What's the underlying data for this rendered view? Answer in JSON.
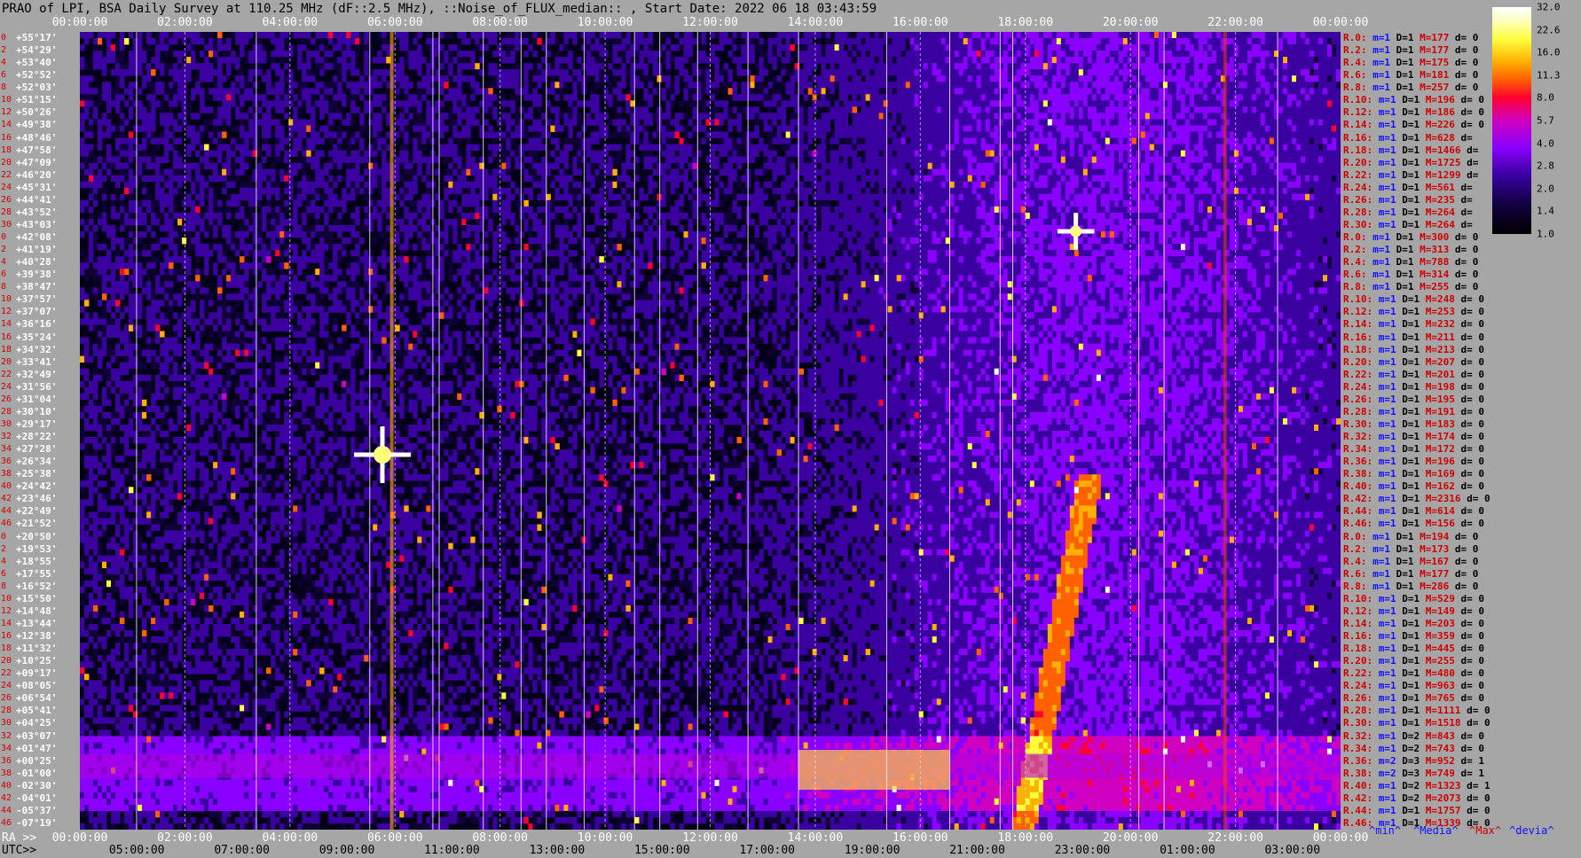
{
  "title": "PRAO of LPI, BSA Daily Survey at 110.25 MHz (dF::2.5 MHz), ::Noise_of_FLUX_median:: , Start Date: 2022 06 18 03:43:59",
  "colors": {
    "background": "#a6a6a6",
    "plot_background": "#05001a",
    "colormap": [
      "#000000",
      "#10003a",
      "#3a00a0",
      "#8a00ff",
      "#d000c0",
      "#ff0030",
      "#ff6000",
      "#ffb000",
      "#ffff40",
      "#ffffff"
    ],
    "stat_red": "#d00000",
    "stat_blue": "#1010ff"
  },
  "axes": {
    "top_ticks": [
      "00:00:00",
      "02:00:00",
      "04:00:00",
      "06:00:00",
      "08:00:00",
      "10:00:00",
      "12:00:00",
      "14:00:00",
      "16:00:00",
      "18:00:00",
      "20:00:00",
      "22:00:00",
      "00:00:00"
    ],
    "bottom_ra_prefix": "RA >>",
    "bottom_ra_ticks": [
      "00:00:00",
      "02:00:00",
      "04:00:00",
      "06:00:00",
      "08:00:00",
      "10:00:00",
      "12:00:00",
      "14:00:00",
      "16:00:00",
      "18:00:00",
      "20:00:00",
      "22:00:00",
      "00:00:00"
    ],
    "bottom_utc_prefix": "UTC>>",
    "bottom_utc_ticks": [
      "05:00:00",
      "07:00:00",
      "09:00:00",
      "11:00:00",
      "13:00:00",
      "15:00:00",
      "17:00:00",
      "19:00:00",
      "21:00:00",
      "23:00:00",
      "01:00:00",
      "03:00:00"
    ]
  },
  "chart_data": {
    "type": "heatmap",
    "title": "PRAO of LPI, BSA Daily Survey at 110.25 MHz (dF::2.5 MHz), ::Noise_of_FLUX_median:: , Start Date: 2022 06 18 03:43:59",
    "x_axis": "RA / UTC time",
    "y_axis": "Declination",
    "declinations": [
      "+55°17'",
      "+54°29'",
      "+53°40'",
      "+52°52'",
      "+52°03'",
      "+51°15'",
      "+50°26'",
      "+49°38'",
      "+48°46'",
      "+47°58'",
      "+47°09'",
      "+46°20'",
      "+45°31'",
      "+44°41'",
      "+43°52'",
      "+43°03'",
      "+42°08'",
      "+41°19'",
      "+40°28'",
      "+39°38'",
      "+38°47'",
      "+37°57'",
      "+37°07'",
      "+36°16'",
      "+35°24'",
      "+34°32'",
      "+33°41'",
      "+32°49'",
      "+31°56'",
      "+31°04'",
      "+30°10'",
      "+29°17'",
      "+28°22'",
      "+27°28'",
      "+26°34'",
      "+25°38'",
      "+24°42'",
      "+23°46'",
      "+22°49'",
      "+21°52'",
      "+20°50'",
      "+19°53'",
      "+18°55'",
      "+17°55'",
      "+16°52'",
      "+15°50'",
      "+14°48'",
      "+13°44'",
      "+12°38'",
      "+11°32'",
      "+10°25'",
      "+09°17'",
      "+08°05'",
      "+06°54'",
      "+05°41'",
      "+04°25'",
      "+03°07'",
      "+01°47'",
      "+00°25'",
      "-01°00'",
      "-02°30'",
      "-04°01'",
      "-05°37'",
      "-07°19'"
    ],
    "row_index": [
      "0",
      "2",
      "4",
      "6",
      "8",
      "10",
      "12",
      "14",
      "16",
      "18",
      "20",
      "22",
      "24",
      "26",
      "28",
      "30",
      "0",
      "2",
      "4",
      "6",
      "8",
      "10",
      "12",
      "14",
      "16",
      "18",
      "20",
      "22",
      "24",
      "26",
      "28",
      "30",
      "32",
      "34",
      "36",
      "38",
      "40",
      "42",
      "44",
      "46",
      "0",
      "2",
      "4",
      "6",
      "8",
      "10",
      "12",
      "14",
      "16",
      "18",
      "20",
      "22",
      "24",
      "26",
      "28",
      "30",
      "32",
      "34",
      "36",
      "38",
      "40",
      "42",
      "44",
      "46"
    ],
    "colorbar": {
      "scale": "log",
      "ticks": [
        "32.0",
        "22.6",
        "16.0",
        "11.3",
        "8.0",
        "5.7",
        "4.0",
        "2.8",
        "2.0",
        "1.4",
        "1.0"
      ]
    },
    "stats": [
      {
        "r": "R.0:",
        "m": "m=1",
        "D": "D=1",
        "M": "M=177",
        "d": "d= 0"
      },
      {
        "r": "R.2:",
        "m": "m=1",
        "D": "D=1",
        "M": "M=177",
        "d": "d= 0"
      },
      {
        "r": "R.4:",
        "m": "m=1",
        "D": "D=1",
        "M": "M=175",
        "d": "d= 0"
      },
      {
        "r": "R.6:",
        "m": "m=1",
        "D": "D=1",
        "M": "M=181",
        "d": "d= 0"
      },
      {
        "r": "R.8:",
        "m": "m=1",
        "D": "D=1",
        "M": "M=257",
        "d": "d= 0"
      },
      {
        "r": "R.10:",
        "m": "m=1",
        "D": "D=1",
        "M": "M=196",
        "d": "d= 0"
      },
      {
        "r": "R.12:",
        "m": "m=1",
        "D": "D=1",
        "M": "M=186",
        "d": "d= 0"
      },
      {
        "r": "R.14:",
        "m": "m=1",
        "D": "D=1",
        "M": "M=226",
        "d": "d= 0"
      },
      {
        "r": "R.16:",
        "m": "m=1",
        "D": "D=1",
        "M": "M=628",
        "d": "d="
      },
      {
        "r": "R.18:",
        "m": "m=1",
        "D": "D=1",
        "M": "M=1466",
        "d": "d="
      },
      {
        "r": "R.20:",
        "m": "m=1",
        "D": "D=1",
        "M": "M=1725",
        "d": "d="
      },
      {
        "r": "R.22:",
        "m": "m=1",
        "D": "D=1",
        "M": "M=1299",
        "d": "d="
      },
      {
        "r": "R.24:",
        "m": "m=1",
        "D": "D=1",
        "M": "M=561",
        "d": "d="
      },
      {
        "r": "R.26:",
        "m": "m=1",
        "D": "D=1",
        "M": "M=235",
        "d": "d="
      },
      {
        "r": "R.28:",
        "m": "m=1",
        "D": "D=1",
        "M": "M=264",
        "d": "d="
      },
      {
        "r": "R.30:",
        "m": "m=1",
        "D": "D=1",
        "M": "M=264",
        "d": "d="
      },
      {
        "r": "R.0:",
        "m": "m=1",
        "D": "D=1",
        "M": "M=300",
        "d": "d= 0"
      },
      {
        "r": "R.2:",
        "m": "m=1",
        "D": "D=1",
        "M": "M=313",
        "d": "d= 0"
      },
      {
        "r": "R.4:",
        "m": "m=1",
        "D": "D=1",
        "M": "M=788",
        "d": "d= 0"
      },
      {
        "r": "R.6:",
        "m": "m=1",
        "D": "D=1",
        "M": "M=314",
        "d": "d= 0"
      },
      {
        "r": "R.8:",
        "m": "m=1",
        "D": "D=1",
        "M": "M=255",
        "d": "d= 0"
      },
      {
        "r": "R.10:",
        "m": "m=1",
        "D": "D=1",
        "M": "M=248",
        "d": "d= 0"
      },
      {
        "r": "R.12:",
        "m": "m=1",
        "D": "D=1",
        "M": "M=253",
        "d": "d= 0"
      },
      {
        "r": "R.14:",
        "m": "m=1",
        "D": "D=1",
        "M": "M=232",
        "d": "d= 0"
      },
      {
        "r": "R.16:",
        "m": "m=1",
        "D": "D=1",
        "M": "M=211",
        "d": "d= 0"
      },
      {
        "r": "R.18:",
        "m": "m=1",
        "D": "D=1",
        "M": "M=213",
        "d": "d= 0"
      },
      {
        "r": "R.20:",
        "m": "m=1",
        "D": "D=1",
        "M": "M=207",
        "d": "d= 0"
      },
      {
        "r": "R.22:",
        "m": "m=1",
        "D": "D=1",
        "M": "M=201",
        "d": "d= 0"
      },
      {
        "r": "R.24:",
        "m": "m=1",
        "D": "D=1",
        "M": "M=198",
        "d": "d= 0"
      },
      {
        "r": "R.26:",
        "m": "m=1",
        "D": "D=1",
        "M": "M=195",
        "d": "d= 0"
      },
      {
        "r": "R.28:",
        "m": "m=1",
        "D": "D=1",
        "M": "M=191",
        "d": "d= 0"
      },
      {
        "r": "R.30:",
        "m": "m=1",
        "D": "D=1",
        "M": "M=183",
        "d": "d= 0"
      },
      {
        "r": "R.32:",
        "m": "m=1",
        "D": "D=1",
        "M": "M=174",
        "d": "d= 0"
      },
      {
        "r": "R.34:",
        "m": "m=1",
        "D": "D=1",
        "M": "M=172",
        "d": "d= 0"
      },
      {
        "r": "R.36:",
        "m": "m=1",
        "D": "D=1",
        "M": "M=196",
        "d": "d= 0"
      },
      {
        "r": "R.38:",
        "m": "m=1",
        "D": "D=1",
        "M": "M=169",
        "d": "d= 0"
      },
      {
        "r": "R.40:",
        "m": "m=1",
        "D": "D=1",
        "M": "M=162",
        "d": "d= 0"
      },
      {
        "r": "R.42:",
        "m": "m=1",
        "D": "D=1",
        "M": "M=2316",
        "d": "d= 0"
      },
      {
        "r": "R.44:",
        "m": "m=1",
        "D": "D=1",
        "M": "M=614",
        "d": "d= 0"
      },
      {
        "r": "R.46:",
        "m": "m=1",
        "D": "D=1",
        "M": "M=156",
        "d": "d= 0"
      },
      {
        "r": "R.0:",
        "m": "m=1",
        "D": "D=1",
        "M": "M=194",
        "d": "d= 0"
      },
      {
        "r": "R.2:",
        "m": "m=1",
        "D": "D=1",
        "M": "M=173",
        "d": "d= 0"
      },
      {
        "r": "R.4:",
        "m": "m=1",
        "D": "D=1",
        "M": "M=167",
        "d": "d= 0"
      },
      {
        "r": "R.6:",
        "m": "m=1",
        "D": "D=1",
        "M": "M=177",
        "d": "d= 0"
      },
      {
        "r": "R.8:",
        "m": "m=1",
        "D": "D=1",
        "M": "M=286",
        "d": "d= 0"
      },
      {
        "r": "R.10:",
        "m": "m=1",
        "D": "D=1",
        "M": "M=529",
        "d": "d= 0"
      },
      {
        "r": "R.12:",
        "m": "m=1",
        "D": "D=1",
        "M": "M=149",
        "d": "d= 0"
      },
      {
        "r": "R.14:",
        "m": "m=1",
        "D": "D=1",
        "M": "M=203",
        "d": "d= 0"
      },
      {
        "r": "R.16:",
        "m": "m=1",
        "D": "D=1",
        "M": "M=359",
        "d": "d= 0"
      },
      {
        "r": "R.18:",
        "m": "m=1",
        "D": "D=1",
        "M": "M=445",
        "d": "d= 0"
      },
      {
        "r": "R.20:",
        "m": "m=1",
        "D": "D=1",
        "M": "M=255",
        "d": "d= 0"
      },
      {
        "r": "R.22:",
        "m": "m=1",
        "D": "D=1",
        "M": "M=480",
        "d": "d= 0"
      },
      {
        "r": "R.24:",
        "m": "m=1",
        "D": "D=1",
        "M": "M=963",
        "d": "d= 0"
      },
      {
        "r": "R.26:",
        "m": "m=1",
        "D": "D=1",
        "M": "M=765",
        "d": "d= 0"
      },
      {
        "r": "R.28:",
        "m": "m=1",
        "D": "D=1",
        "M": "M=1111",
        "d": "d= 0"
      },
      {
        "r": "R.30:",
        "m": "m=1",
        "D": "D=1",
        "M": "M=1518",
        "d": "d= 0"
      },
      {
        "r": "R.32:",
        "m": "m=1",
        "D": "D=2",
        "M": "M=843",
        "d": "d= 0"
      },
      {
        "r": "R.34:",
        "m": "m=1",
        "D": "D=2",
        "M": "M=743",
        "d": "d= 0"
      },
      {
        "r": "R.36:",
        "m": "m=2",
        "D": "D=3",
        "M": "M=952",
        "d": "d= 1"
      },
      {
        "r": "R.38:",
        "m": "m=2",
        "D": "D=3",
        "M": "M=749",
        "d": "d= 1"
      },
      {
        "r": "R.40:",
        "m": "m=1",
        "D": "D=2",
        "M": "M=1323",
        "d": "d= 1"
      },
      {
        "r": "R.42:",
        "m": "m=1",
        "D": "D=2",
        "M": "M=2073",
        "d": "d= 0"
      },
      {
        "r": "R.44:",
        "m": "m=1",
        "D": "D=1",
        "M": "M=1757",
        "d": "d= 0"
      },
      {
        "r": "R.46:",
        "m": "m=1",
        "D": "D=1",
        "M": "M=1339",
        "d": "d= 0"
      }
    ],
    "legend": {
      "min": "^min^",
      "median": "^Media^",
      "max": "^Max^",
      "deviation": "^devia^"
    }
  }
}
